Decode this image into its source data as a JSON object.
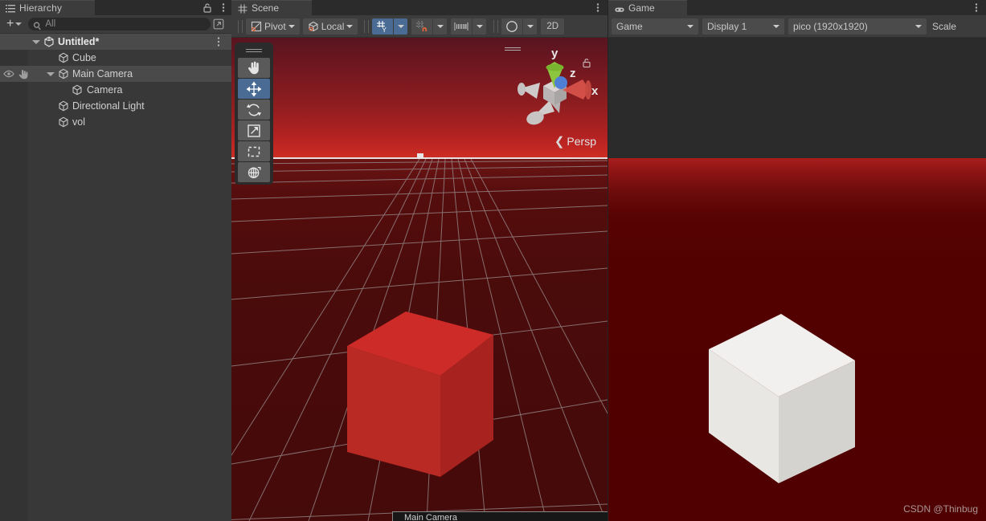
{
  "hierarchy": {
    "tab_label": "Hierarchy",
    "tab_icon": "hierarchy-icon",
    "add_label": "+",
    "search": {
      "placeholder": "All",
      "value": "",
      "icon": "search-icon"
    },
    "scene_name": "Untitled*",
    "items": [
      {
        "label": "Cube",
        "depth": 1,
        "expandable": false,
        "selected": false,
        "visibility_icons": false
      },
      {
        "label": "Main Camera",
        "depth": 1,
        "expandable": true,
        "selected": true,
        "visibility_icons": true
      },
      {
        "label": "Camera",
        "depth": 2,
        "expandable": false,
        "selected": false,
        "visibility_icons": false
      },
      {
        "label": "Directional Light",
        "depth": 1,
        "expandable": false,
        "selected": false,
        "visibility_icons": false
      },
      {
        "label": "vol",
        "depth": 1,
        "expandable": false,
        "selected": false,
        "visibility_icons": false
      }
    ]
  },
  "scene": {
    "tab_label": "Scene",
    "tab_icon": "grid-icon",
    "toolbar": {
      "pivot_label": "Pivot",
      "pivot_icon": "pivot-icon",
      "handle_label": "Local",
      "handle_icon": "local-handle-icon",
      "grid_snap_icon": "grid-y-snap-icon",
      "grid_snap_active": true,
      "magnet_snap_icon": "magnet-snap-icon",
      "ruler_snap_icon": "ruler-snap-icon",
      "lighting_icon": "lighting-sphere-icon",
      "twod_label": "2D"
    },
    "tools": [
      {
        "name": "hand-tool",
        "icon": "hand-icon",
        "active": false
      },
      {
        "name": "move-tool",
        "icon": "move-icon",
        "active": true
      },
      {
        "name": "rotate-tool",
        "icon": "rotate-icon",
        "active": false
      },
      {
        "name": "scale-tool",
        "icon": "scale-icon",
        "active": false
      },
      {
        "name": "rect-tool",
        "icon": "rect-icon",
        "active": false
      },
      {
        "name": "transform-tool",
        "icon": "transform-icon",
        "active": false
      }
    ],
    "gizmo": {
      "axis_x": "x",
      "axis_y": "y",
      "axis_z": "z",
      "projection_label": "Persp",
      "lock_icon": "unlocked-icon"
    },
    "camera_preview_label": "Main Camera",
    "colors": {
      "sky_top": "#581520",
      "sky_horizon": "#cf3024",
      "ground": "#4a0b0b",
      "grid_line": "#9a9090",
      "cube_top": "#cc2b27",
      "cube_front": "#b92a25",
      "cube_side": "#a8221f"
    }
  },
  "game": {
    "tab_label": "Game",
    "tab_icon": "gamepad-icon",
    "toolbar": {
      "mode_label": "Game",
      "display_label": "Display 1",
      "resolution_label": "pico (1920x1920)",
      "scale_label": "Scale"
    },
    "colors": {
      "background": "#500000",
      "top_band": "#a81d1d",
      "cube_top": "#f2f0ee",
      "cube_front": "#e9e7e4",
      "cube_side": "#d5d3d0"
    }
  },
  "watermark": "CSDN @Thinbug"
}
